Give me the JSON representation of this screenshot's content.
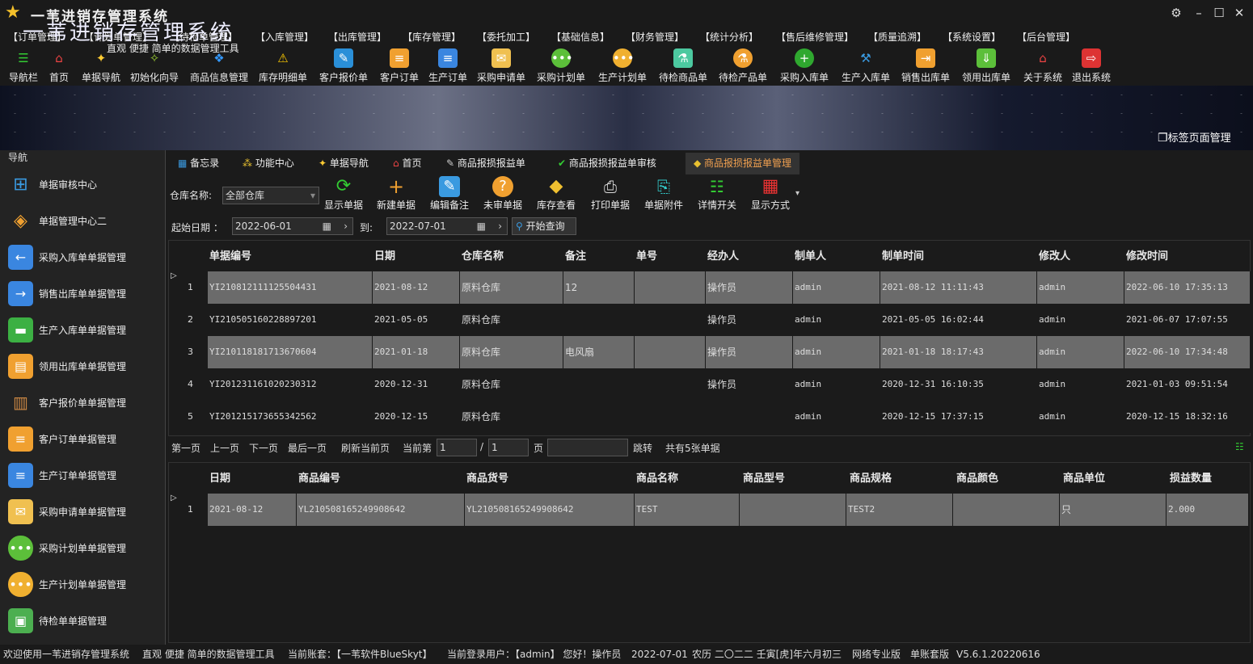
{
  "app": {
    "title": "一苇进销存管理系统"
  },
  "menu": [
    "【订单管理】",
    "【计划单管理】",
    "【待检单管理】",
    "【入库管理】",
    "【出库管理】",
    "【库存管理】",
    "【委托加工】",
    "【基础信息】",
    "【财务管理】",
    "【统计分析】",
    "【售后维修管理】",
    "【质量追溯】",
    "【系统设置】",
    "【后台管理】"
  ],
  "toolbar": [
    "导航栏",
    "首页",
    "单据导航",
    "初始化向导",
    "商品信息管理",
    "库存明细单",
    "客户报价单",
    "客户订单",
    "生产订单",
    "采购申请单",
    "采购计划单",
    "生产计划单",
    "待检商品单",
    "待检产品单",
    "采购入库单",
    "生产入库单",
    "销售出库单",
    "领用出库单",
    "关于系统",
    "退出系统"
  ],
  "banner": {
    "title": "一苇进销存管理系统",
    "subtitle": "直观 便捷 简单的数据管理工具",
    "tag_manager": "标签页面管理"
  },
  "sidebar": {
    "title": "导航",
    "items": [
      "单据审核中心",
      "单据管理中心二",
      "采购入库单单据管理",
      "销售出库单单据管理",
      "生产入库单单据管理",
      "领用出库单单据管理",
      "客户报价单单据管理",
      "客户订单单据管理",
      "生产订单单据管理",
      "采购申请单单据管理",
      "采购计划单单据管理",
      "生产计划单单据管理",
      "待检单单据管理"
    ]
  },
  "tabs": [
    "备忘录",
    "功能中心",
    "单据导航",
    "首页",
    "商品报损报益单",
    "商品报损报益单审核",
    "商品报损报益单管理"
  ],
  "filter": {
    "warehouse_label": "仓库名称:",
    "warehouse_value": "全部仓库",
    "start_label": "起始日期 ：",
    "start_value": "2022-06-01",
    "to_label": "到:",
    "end_value": "2022-07-01",
    "query_label": "开始查询"
  },
  "ops": [
    "显示单据",
    "新建单据",
    "编辑备注",
    "未审单据",
    "库存查看",
    "打印单据",
    "单据附件",
    "详情开关",
    "显示方式"
  ],
  "main_table": {
    "headers": [
      "单据编号",
      "日期",
      "仓库名称",
      "备注",
      "单号",
      "经办人",
      "制单人",
      "制单时间",
      "修改人",
      "修改时间"
    ],
    "rows": [
      [
        "1",
        "YI210812111125504431",
        "2021-08-12",
        "原料仓库",
        "12",
        "",
        "操作员",
        "admin",
        "2021-08-12 11:11:43",
        "admin",
        "2022-06-10 17:35:13"
      ],
      [
        "2",
        "YI210505160228897201",
        "2021-05-05",
        "原料仓库",
        "",
        "",
        "操作员",
        "admin",
        "2021-05-05 16:02:44",
        "admin",
        "2021-06-07 17:07:55"
      ],
      [
        "3",
        "YI210118181713670604",
        "2021-01-18",
        "原料仓库",
        "电风扇",
        "",
        "操作员",
        "admin",
        "2021-01-18 18:17:43",
        "admin",
        "2022-06-10 17:34:48"
      ],
      [
        "4",
        "YI201231161020230312",
        "2020-12-31",
        "原料仓库",
        "",
        "",
        "操作员",
        "admin",
        "2020-12-31 16:10:35",
        "admin",
        "2021-01-03 09:51:54"
      ],
      [
        "5",
        "YI201215173655342562",
        "2020-12-15",
        "原料仓库",
        "",
        "",
        "",
        "admin",
        "2020-12-15 17:37:15",
        "admin",
        "2020-12-15 18:32:16"
      ]
    ]
  },
  "pager": {
    "first": "第一页",
    "prev": "上一页",
    "next": "下一页",
    "last": "最后一页",
    "refresh": "刷新当前页",
    "current_label": "当前第",
    "current": "1",
    "sep": "/",
    "total_pages": "1",
    "page_unit": "页",
    "jump": "跳转",
    "total": "共有5张单据"
  },
  "detail_table": {
    "headers": [
      "日期",
      "商品编号",
      "商品货号",
      "商品名称",
      "商品型号",
      "商品规格",
      "商品颜色",
      "商品单位",
      "损益数量"
    ],
    "rows": [
      [
        "1",
        "2021-08-12",
        "YL210508165249908642",
        "YL210508165249908642",
        "TEST",
        "",
        "TEST2",
        "",
        "只",
        "2.000"
      ]
    ]
  },
  "status": {
    "welcome": "欢迎使用一苇进销存管理系统",
    "slogan": "直观 便捷 简单的数据管理工具",
    "account": "当前账套：【一苇软件BlueSkyt】",
    "user": "当前登录用户：【admin】 您好！操作员",
    "date": "2022-07-01",
    "lunar": "农历 二〇二二 壬寅[虎]年六月初三",
    "edition": "网络专业版",
    "mode": "单账套版",
    "version": "V5.6.1.20220616"
  },
  "colors": {
    "accent": "#f0a050",
    "highlight_row": "#6b6b6b",
    "bg": "#1b1b1b"
  }
}
